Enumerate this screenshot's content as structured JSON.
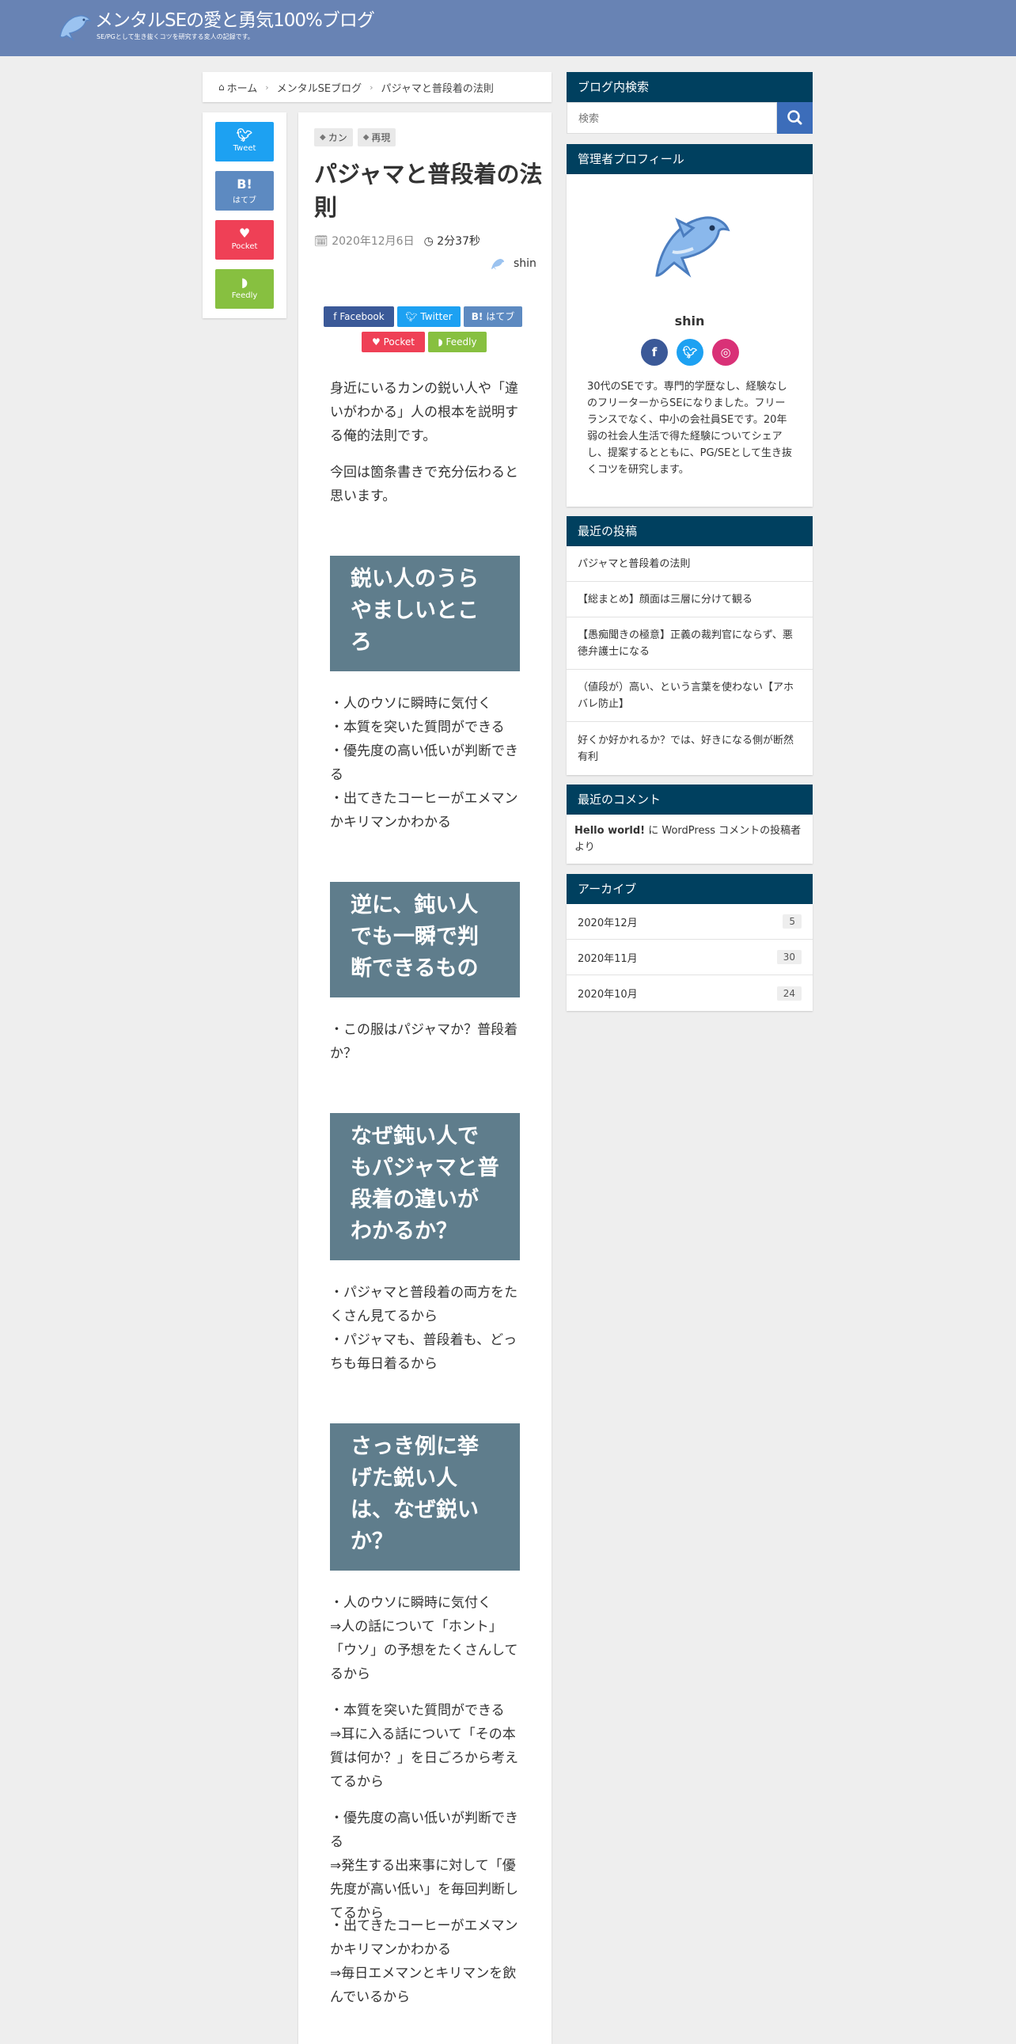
{
  "header": {
    "site_title": "メンタルSEの愛と勇気100%ブログ",
    "site_subtitle": "SE/PGとして生き抜くコツを研究する変人の記録です。"
  },
  "breadcrumb": {
    "home": "ホーム",
    "category": "メンタルSEブログ",
    "current": "パジャマと普段着の法則"
  },
  "share_sidebar": {
    "tweet": "Tweet",
    "hatena_icon": "B!",
    "hatena": "はてブ",
    "pocket": "Pocket",
    "feedly": "Feedly"
  },
  "article": {
    "tags": [
      "カン",
      "再現"
    ],
    "title": "パジャマと普段着の法則",
    "date": "2020年12月6日",
    "read_time": "2分37秒",
    "author": "shin",
    "share_buttons": {
      "facebook": "Facebook",
      "twitter": "Twitter",
      "hatena": "はてブ",
      "pocket": "Pocket",
      "feedly": "Feedly"
    },
    "intro1": "身近にいるカンの鋭い人や「違いがわかる」人の根本を説明する俺的法則です。",
    "intro2": "今回は箇条書きで充分伝わると思います。",
    "h2_1": "鋭い人のうらやましいところ",
    "list1": "・人のウソに瞬時に気付く\n・本質を突いた質問ができる\n・優先度の高い低いが判断できる\n・出てきたコーヒーがエメマンかキリマンかわかる",
    "h2_2": "逆に、鈍い人でも一瞬で判断できるもの",
    "list2": "・この服はパジャマか？普段着か？",
    "h2_3": "なぜ鈍い人でもパジャマと普段着の違いがわかるか？",
    "list3": "・パジャマと普段着の両方をたくさん見てるから\n・パジャマも、普段着も、どっちも毎日着るから",
    "h2_4": "さっき例に挙げた鋭い人は、なぜ鋭いか？",
    "para4a": "・人のウソに瞬時に気付く\n⇒人の話について「ホント」「ウソ」の予想をたくさんしてるから",
    "para4b": "・本質を突いた質問ができる\n⇒耳に入る話について「その本質は何か？」を日ごろから考えてるから",
    "para4c": "・優先度の高い低いが判断できる\n⇒発生する出来事に対して「優先度が高い低い」を毎回判断してるから",
    "para4d": "・出てきたコーヒーがエメマンかキリマンかわかる\n⇒毎日エメマンとキリマンを飲んでいるから"
  },
  "sidebar": {
    "search": {
      "title": "ブログ内検索",
      "placeholder": "検索"
    },
    "profile": {
      "title": "管理者プロフィール",
      "name": "shin",
      "text": "30代のSEです。専門的学歴なし、経験なしのフリーターからSEになりました。フリーランスでなく、中小の会社員SEです。20年弱の社会人生活で得た経験についてシェアし、提案するとともに、PG/SEとして生き抜くコツを研究します。"
    },
    "recent_posts": {
      "title": "最近の投稿",
      "items": [
        "パジャマと普段着の法則",
        "【総まとめ】顔面は三層に分けて観る",
        "【愚痴聞きの極意】正義の裁判官にならず、悪徳弁護士になる",
        "（値段が）高い、という言葉を使わない【アホバレ防止】",
        "好くか好かれるか？では、好きになる側が断然有利"
      ]
    },
    "recent_comments": {
      "title": "最近のコメント",
      "post": "Hello world!",
      "connector": " に ",
      "author": "WordPress コメントの投稿者",
      "suffix": " より"
    },
    "archives": {
      "title": "アーカイブ",
      "items": [
        {
          "month": "2020年12月",
          "count": "5"
        },
        {
          "month": "2020年11月",
          "count": "30"
        },
        {
          "month": "2020年10月",
          "count": "24"
        }
      ]
    }
  },
  "colors": {
    "header": "#6883b4",
    "widget_head": "#00405f",
    "h2_bg": "#5f7d8c",
    "twitter": "#1da1f2",
    "hatena": "#5d8ac1",
    "pocket": "#ef4056",
    "feedly": "#87c040",
    "facebook": "#3b5998",
    "instagram": "#d93177"
  },
  "icons": [
    "dolphin-logo",
    "home-icon",
    "tag-icon",
    "clock-icon",
    "search-icon",
    "twitter-icon",
    "facebook-icon",
    "instagram-icon",
    "pocket-icon",
    "feedly-icon"
  ]
}
